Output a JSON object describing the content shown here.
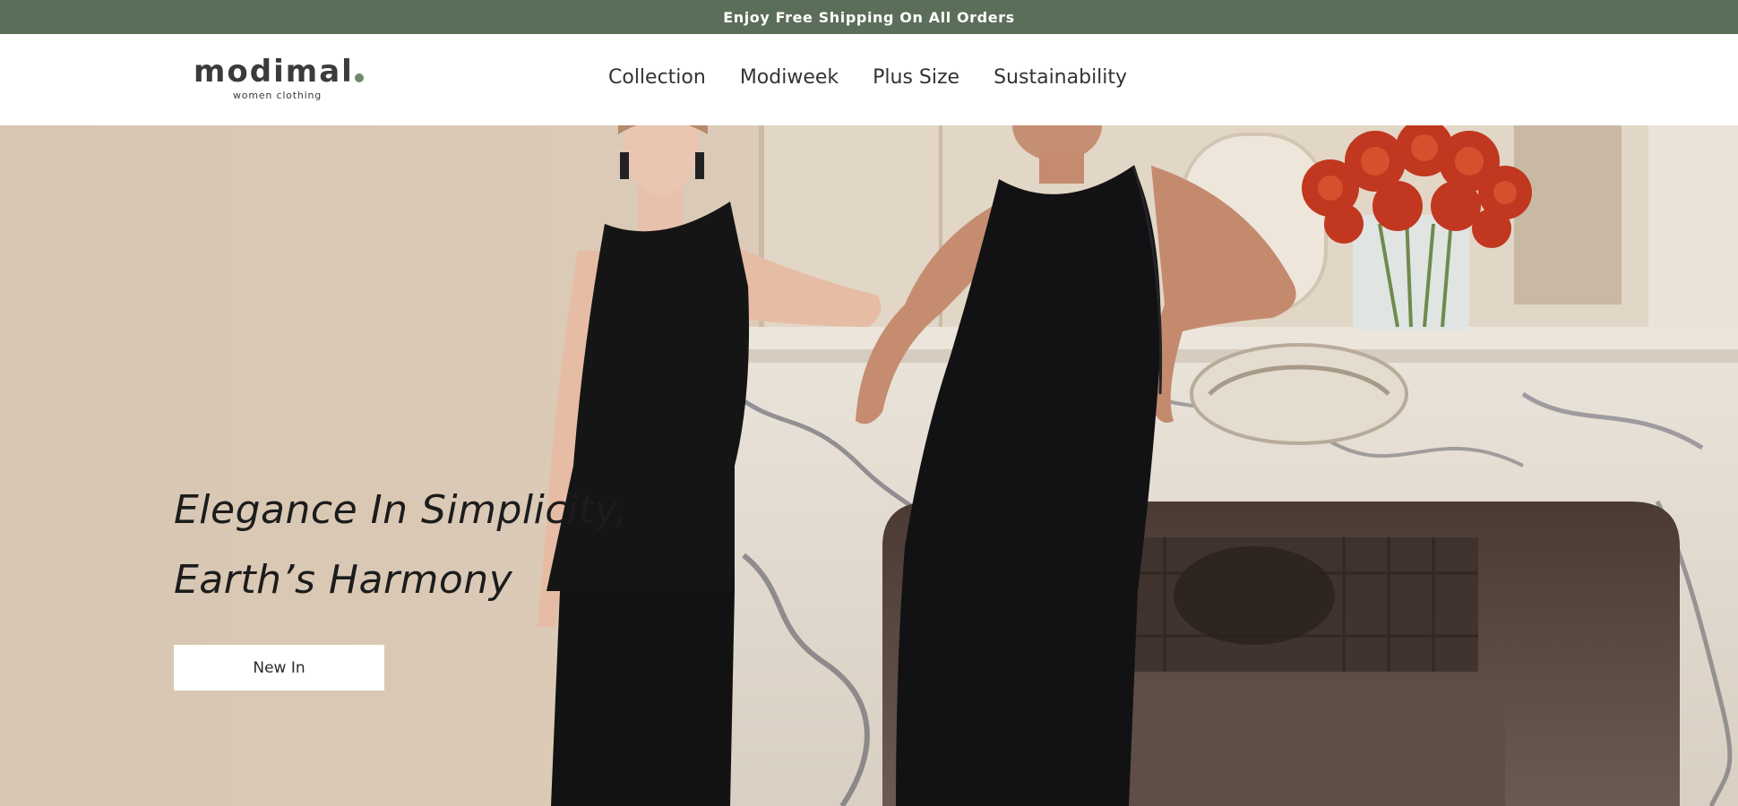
{
  "announcement": {
    "text": "Enjoy Free Shipping On All Orders"
  },
  "brand": {
    "name": "modimal",
    "tagline": "women clothing",
    "accent_color": "#6e8a6a"
  },
  "nav": {
    "items": [
      {
        "label": "Collection"
      },
      {
        "label": "Modiweek"
      },
      {
        "label": "Plus Size"
      },
      {
        "label": "Sustainability"
      }
    ]
  },
  "hero": {
    "headline_line1": "Elegance In Simplicity,",
    "headline_line2": "Earth’s Harmony",
    "cta_label": "New In"
  },
  "colors": {
    "announcement_bg": "#5b6e5a",
    "header_bg": "#ffffff",
    "text_dark": "#1c1c1c"
  }
}
